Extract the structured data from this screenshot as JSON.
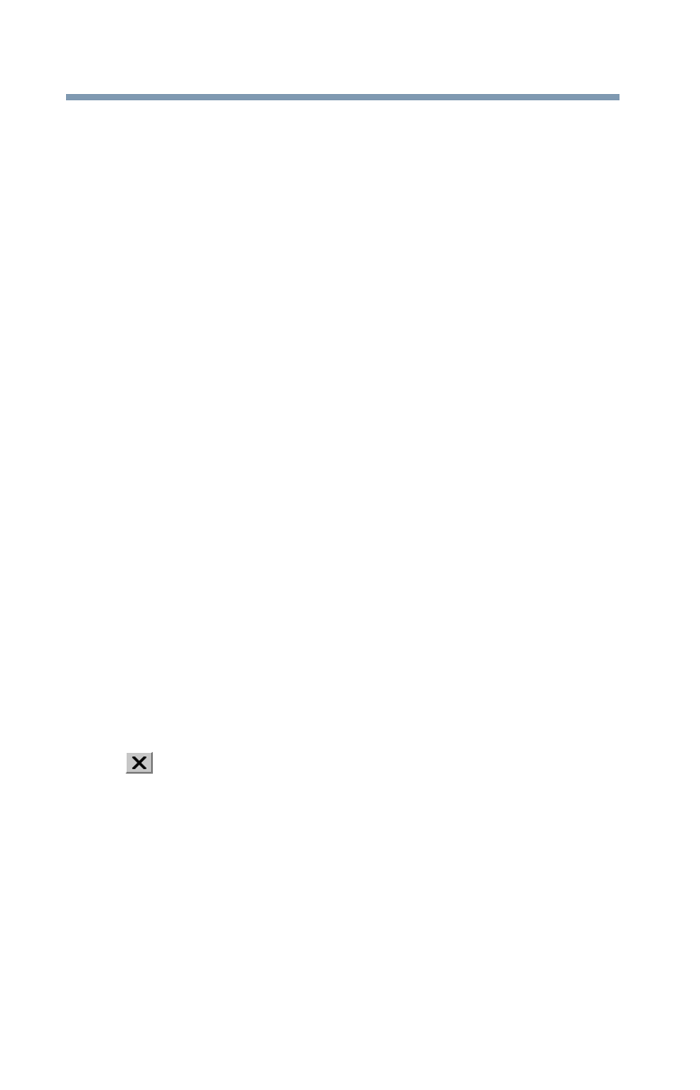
{
  "colors": {
    "header_rule": "#7f99b1",
    "button_face": "#c7c7c7",
    "button_shadow": "#7d7d7d",
    "button_highlight": "#ffffff",
    "glyph": "#000000"
  },
  "icons": {
    "close": "close-icon"
  }
}
